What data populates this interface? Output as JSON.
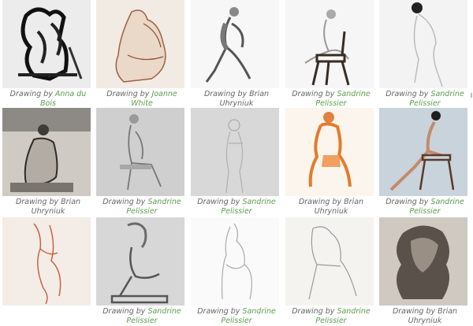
{
  "gallery": {
    "prefix": "Drawing by",
    "items": [
      {
        "artist": "Anna du Bois",
        "linked": true,
        "image": "ink-seated-figure"
      },
      {
        "artist": "Joanne White",
        "linked": true,
        "image": "sepia-seated-figure"
      },
      {
        "artist": "Brian Uhryniuk",
        "linked": false,
        "image": "graphite-crouching-figure"
      },
      {
        "artist": "Sandrine Pelissier",
        "linked": true,
        "image": "figure-on-chair-back-view"
      },
      {
        "artist": "Sandrine Pelissier",
        "linked": true,
        "image": "pale-seated-figure"
      },
      {
        "artist": "Brian Uhryniuk",
        "linked": false,
        "image": "charcoal-seated-back-view"
      },
      {
        "artist": "Sandrine Pelissier",
        "linked": true,
        "image": "grey-seated-figure"
      },
      {
        "artist": "Sandrine Pelissier",
        "linked": true,
        "image": "faint-standing-figure"
      },
      {
        "artist": "Brian Uhryniuk",
        "linked": false,
        "image": "orange-seated-figure"
      },
      {
        "artist": "Sandrine Pelissier",
        "linked": true,
        "image": "figure-on-stool-blue-ground"
      },
      {
        "artist": "",
        "linked": true,
        "image": "red-line-reclining-figure"
      },
      {
        "artist": "Sandrine Pelissier",
        "linked": true,
        "image": "graphite-seated-woman"
      },
      {
        "artist": "Sandrine Pelissier",
        "linked": true,
        "image": "line-drawing-seated-figure"
      },
      {
        "artist": "Sandrine Pelissier",
        "linked": true,
        "image": "leaning-seated-figure"
      },
      {
        "artist": "Brian Uhryniuk",
        "linked": false,
        "image": "charcoal-crouching-figure"
      }
    ]
  }
}
